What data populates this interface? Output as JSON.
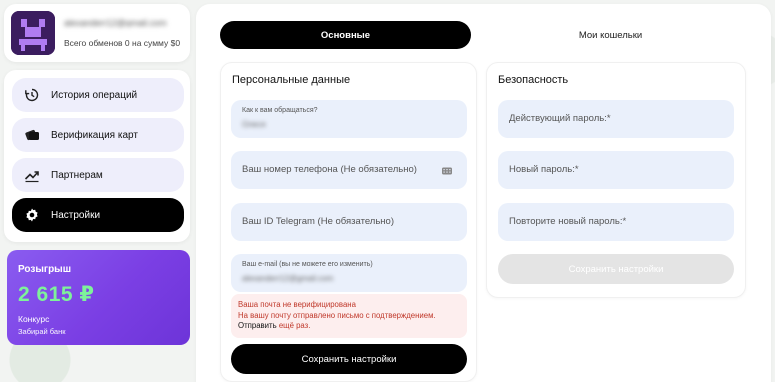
{
  "profile": {
    "email": "alexanderr12@gmail.com",
    "stats": "Всего обменов 0 на сумму $0"
  },
  "menu": {
    "items": [
      {
        "label": "История операций",
        "icon": "history-icon"
      },
      {
        "label": "Верификация карт",
        "icon": "card-icon"
      },
      {
        "label": "Партнерам",
        "icon": "trend-icon"
      },
      {
        "label": "Настройки",
        "icon": "gear-icon"
      }
    ],
    "active_index": 3
  },
  "promo": {
    "title": "Розыгрыш",
    "amount": "2 615 ₽",
    "type": "Конкурс",
    "subtitle": "Забирай банк",
    "accent": "#7ef29a",
    "background": "#7b3fe4"
  },
  "tabs": [
    {
      "label": "Основные",
      "active": true
    },
    {
      "label": "Мои кошельки",
      "active": false
    }
  ],
  "personal": {
    "title": "Персональные данные",
    "name_label": "Как к вам обращаться?",
    "name_value": "Олеся",
    "phone_placeholder": "Ваш номер телефона (Не обязательно)",
    "telegram_placeholder": "Ваш ID Telegram (Не обязательно)",
    "email_label": "Ваш e-mail (вы не можете его изменить)",
    "email_value": "alexanderr12@gmail.com",
    "notice_line1": "Ваша почта не верифицирована",
    "notice_line2": "На вашу почту отправлено письмо с подтверждением.",
    "notice_link": "Отправить",
    "notice_rest": "ещё раз.",
    "save_label": "Сохранить настройки"
  },
  "security": {
    "title": "Безопасность",
    "current_password": "Действующий пароль:*",
    "new_password": "Новый пароль:*",
    "repeat_password": "Повторите новый пароль:*",
    "save_label": "Сохранить настройки"
  }
}
